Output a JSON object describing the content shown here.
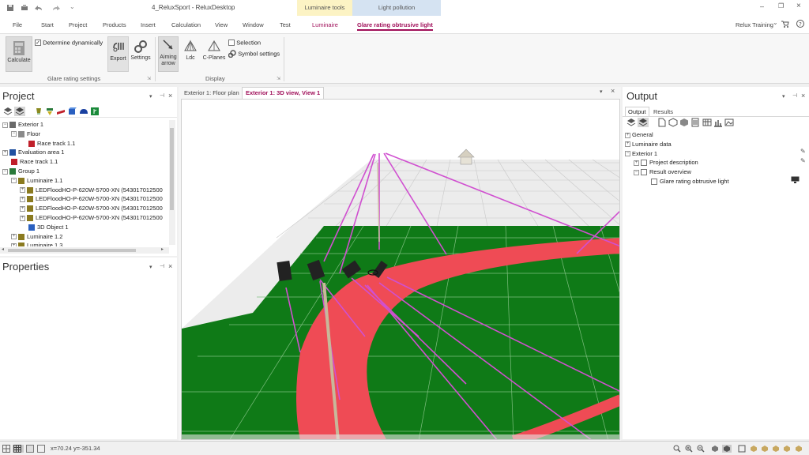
{
  "titlebar": {
    "title": "4_ReluxSport - ReluxDesktop",
    "ctx_tab_luminaire": "Luminaire tools",
    "ctx_tab_light": "Light pollution",
    "colors": {
      "luminaire_tools": "#fcf3c4",
      "light_pollution": "#d5e3f2",
      "accent": "#a0105a"
    }
  },
  "menu": {
    "items": [
      "File",
      "Start",
      "Project",
      "Products",
      "Insert",
      "Calculation",
      "View",
      "Window",
      "Test"
    ],
    "ctx_luminaire": "Luminaire",
    "ctx_glare": "Glare rating obtrusive light",
    "user": "Relux Training"
  },
  "ribbon": {
    "calculate": "Calculate",
    "determine_dynamically": "Determine dynamically",
    "export": "Export",
    "settings": "Settings",
    "group_glare": "Glare rating settings",
    "aiming_arrow_1": "Aiming",
    "aiming_arrow_2": "arrow",
    "ldc": "Ldc",
    "c_planes": "C-Planes",
    "selection": "Selection",
    "symbol_settings": "Symbol settings",
    "group_display": "Display"
  },
  "project_panel": {
    "title": "Project",
    "tree": [
      {
        "label": "Exterior 1",
        "indent": 0,
        "exp": "−",
        "icon": "exterior-icon"
      },
      {
        "label": "Floor",
        "indent": 1,
        "exp": "−",
        "icon": "floor-icon"
      },
      {
        "label": "Race track  1.1",
        "indent": 2,
        "exp": "",
        "icon": "race-track-icon"
      },
      {
        "label": "Evaluation area 1",
        "indent": 0,
        "exp": "+",
        "icon": "evaluation-area-icon"
      },
      {
        "label": "Race track  1.1",
        "indent": 0,
        "exp": "",
        "icon": "race-track-icon"
      },
      {
        "label": "Group  1",
        "indent": 0,
        "exp": "−",
        "icon": "group-icon"
      },
      {
        "label": "Luminaire  1.1",
        "indent": 1,
        "exp": "−",
        "icon": "luminaire-icon"
      },
      {
        "label": "LEDFloodHO-P-620W-5700-XN (543017012500",
        "indent": 2,
        "exp": "+",
        "icon": "luminaire-icon"
      },
      {
        "label": "LEDFloodHO-P-620W-5700-XN (543017012500",
        "indent": 2,
        "exp": "+",
        "icon": "luminaire-icon"
      },
      {
        "label": "LEDFloodHO-P-620W-5700-XN (543017012500",
        "indent": 2,
        "exp": "+",
        "icon": "luminaire-icon"
      },
      {
        "label": "LEDFloodHO-P-620W-5700-XN (543017012500",
        "indent": 2,
        "exp": "+",
        "icon": "luminaire-icon"
      },
      {
        "label": "3D Object  1",
        "indent": 2,
        "exp": "",
        "icon": "object-3d-icon"
      },
      {
        "label": "Luminaire  1.2",
        "indent": 1,
        "exp": "+",
        "icon": "luminaire-icon"
      },
      {
        "label": "Luminaire  1.3",
        "indent": 1,
        "exp": "+",
        "icon": "luminaire-icon"
      }
    ]
  },
  "properties_panel": {
    "title": "Properties"
  },
  "view_tabs": {
    "floor_plan": "Exterior 1: Floor plan",
    "view_3d": "Exterior 1: 3D view, View 1"
  },
  "output_panel": {
    "title": "Output",
    "tab_output": "Output",
    "tab_results": "Results",
    "tree": [
      {
        "label": "General",
        "indent": 0,
        "exp": "+"
      },
      {
        "label": "Luminaire data",
        "indent": 0,
        "exp": "+"
      },
      {
        "label": "Exterior 1",
        "indent": 0,
        "exp": "−"
      },
      {
        "label": "Project description",
        "indent": 1,
        "exp": "+"
      },
      {
        "label": "Result overview",
        "indent": 1,
        "exp": "−"
      },
      {
        "label": "Glare rating obtrusive light",
        "indent": 2,
        "exp": ""
      }
    ]
  },
  "status": {
    "coords": "x=70.24 y=-351.34"
  }
}
